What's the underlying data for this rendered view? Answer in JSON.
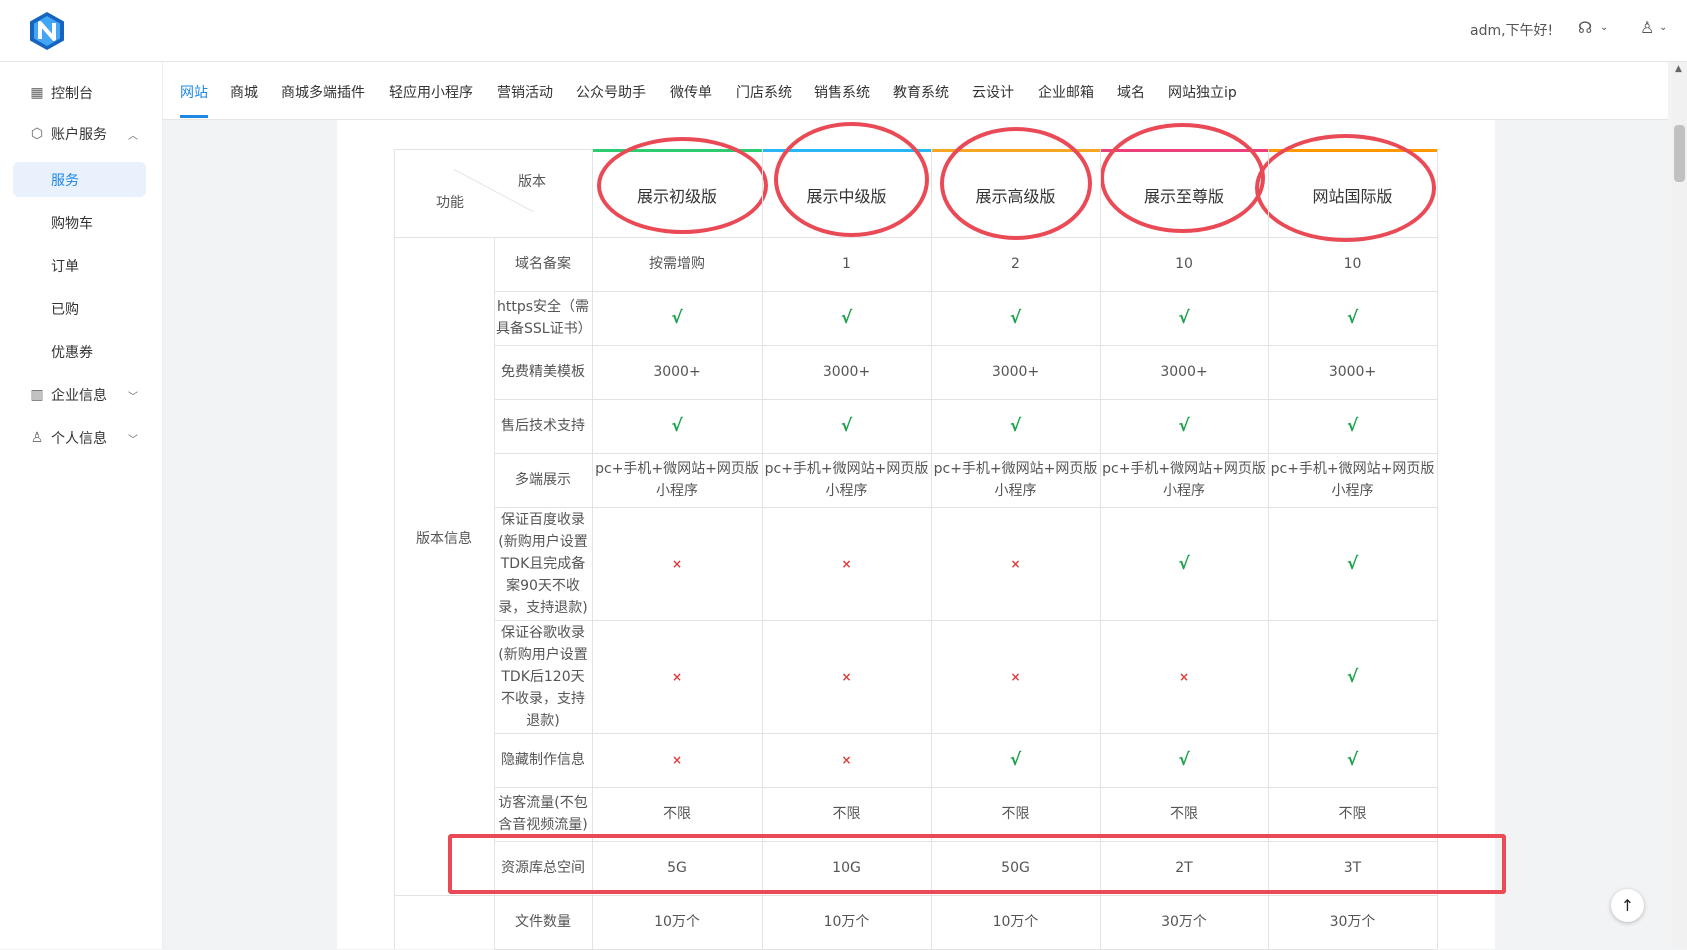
{
  "header": {
    "greeting": "adm,下午好!",
    "support_icon": "headset-icon",
    "user_icon": "user-icon",
    "logo_icon": "n-logo-icon"
  },
  "sidebar": {
    "items": [
      {
        "label": "控制台",
        "icon": "grid-icon"
      },
      {
        "label": "账户服务",
        "icon": "box-icon",
        "expanded": true
      },
      {
        "label": "服务",
        "active": true
      },
      {
        "label": "购物车"
      },
      {
        "label": "订单"
      },
      {
        "label": "已购"
      },
      {
        "label": "优惠券"
      },
      {
        "label": "企业信息",
        "icon": "building-icon"
      },
      {
        "label": "个人信息",
        "icon": "person-icon"
      }
    ]
  },
  "tabs": [
    "网站",
    "商城",
    "商城多端插件",
    "轻应用小程序",
    "营销活动",
    "公众号助手",
    "微传单",
    "门店系统",
    "销售系统",
    "教育系统",
    "云设计",
    "企业邮箱",
    "域名",
    "网站独立ip"
  ],
  "active_tab": "网站",
  "table": {
    "corner_top": "版本",
    "corner_bottom": "功能",
    "group_label": "版本信息",
    "versions": [
      "展示初级版",
      "展示中级版",
      "展示高级版",
      "展示至尊版",
      "网站国际版"
    ],
    "strip_colors": [
      "#2ecc71",
      "#29b6f6",
      "#f5a623",
      "#ec407a",
      "#ff9800"
    ],
    "rows": [
      {
        "feature": "域名备案",
        "values": [
          "按需增购",
          "1",
          "2",
          "10",
          "10"
        ]
      },
      {
        "feature": "https安全（需具备SSL证书）",
        "values": [
          "check",
          "check",
          "check",
          "check",
          "check"
        ]
      },
      {
        "feature": "免费精美模板",
        "values": [
          "3000+",
          "3000+",
          "3000+",
          "3000+",
          "3000+"
        ]
      },
      {
        "feature": "售后技术支持",
        "values": [
          "check",
          "check",
          "check",
          "check",
          "check"
        ]
      },
      {
        "feature": "多端展示",
        "values": [
          "pc+手机+微网站+网页版小程序",
          "pc+手机+微网站+网页版小程序",
          "pc+手机+微网站+网页版小程序",
          "pc+手机+微网站+网页版小程序",
          "pc+手机+微网站+网页版小程序"
        ]
      },
      {
        "feature": "保证百度收录(新购用户设置TDK且完成备案90天不收录，支持退款)",
        "values": [
          "cross",
          "cross",
          "cross",
          "check",
          "check"
        ]
      },
      {
        "feature": "保证谷歌收录(新购用户设置TDK后120天不收录，支持退款)",
        "values": [
          "cross",
          "cross",
          "cross",
          "cross",
          "check"
        ]
      },
      {
        "feature": "隐藏制作信息",
        "values": [
          "cross",
          "cross",
          "check",
          "check",
          "check"
        ]
      },
      {
        "feature": "访客流量(不包含音视频流量)",
        "values": [
          "不限",
          "不限",
          "不限",
          "不限",
          "不限"
        ]
      },
      {
        "feature": "资源库总空间",
        "values": [
          "5G",
          "10G",
          "50G",
          "2T",
          "3T"
        ]
      },
      {
        "feature": "文件数量",
        "values": [
          "10万个",
          "10万个",
          "10万个",
          "30万个",
          "30万个"
        ]
      }
    ],
    "check_symbol": "√",
    "cross_symbol": "×"
  },
  "to_top_icon": "arrow-up-icon"
}
